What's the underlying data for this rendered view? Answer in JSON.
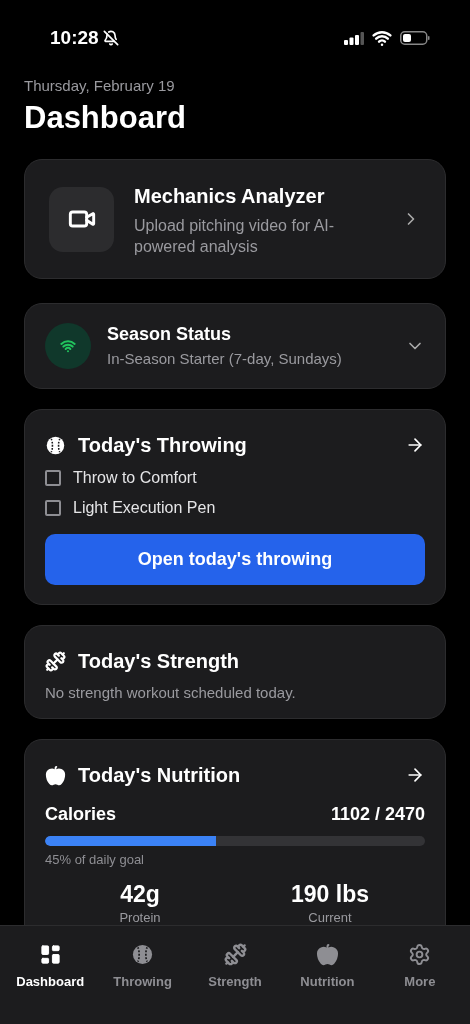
{
  "status_bar": {
    "time": "10:28"
  },
  "header": {
    "date": "Thursday, February 19",
    "title": "Dashboard"
  },
  "mechanics": {
    "title": "Mechanics Analyzer",
    "subtitle": "Upload pitching video for AI-powered analysis"
  },
  "season": {
    "title": "Season Status",
    "subtitle": "In-Season Starter (7-day, Sundays)",
    "expanded": false
  },
  "throwing": {
    "title": "Today's Throwing",
    "items": [
      {
        "label": "Throw to Comfort",
        "checked": false
      },
      {
        "label": "Light Execution Pen",
        "checked": false
      }
    ],
    "button": "Open today's throwing"
  },
  "strength": {
    "title": "Today's Strength",
    "message": "No strength workout scheduled today."
  },
  "nutrition": {
    "title": "Today's Nutrition",
    "calories_label": "Calories",
    "calories_value": "1102 / 2470",
    "level": 0.45,
    "goal_text": "45% of daily goal",
    "stats": [
      {
        "value": "42g",
        "label": "Protein"
      },
      {
        "value": "190 lbs",
        "label": "Current"
      }
    ]
  },
  "tabs": [
    {
      "label": "Dashboard",
      "selected": true
    },
    {
      "label": "Throwing",
      "selected": false
    },
    {
      "label": "Strength",
      "selected": false
    },
    {
      "label": "Nutrition",
      "selected": false
    },
    {
      "label": "More",
      "selected": false
    }
  ]
}
